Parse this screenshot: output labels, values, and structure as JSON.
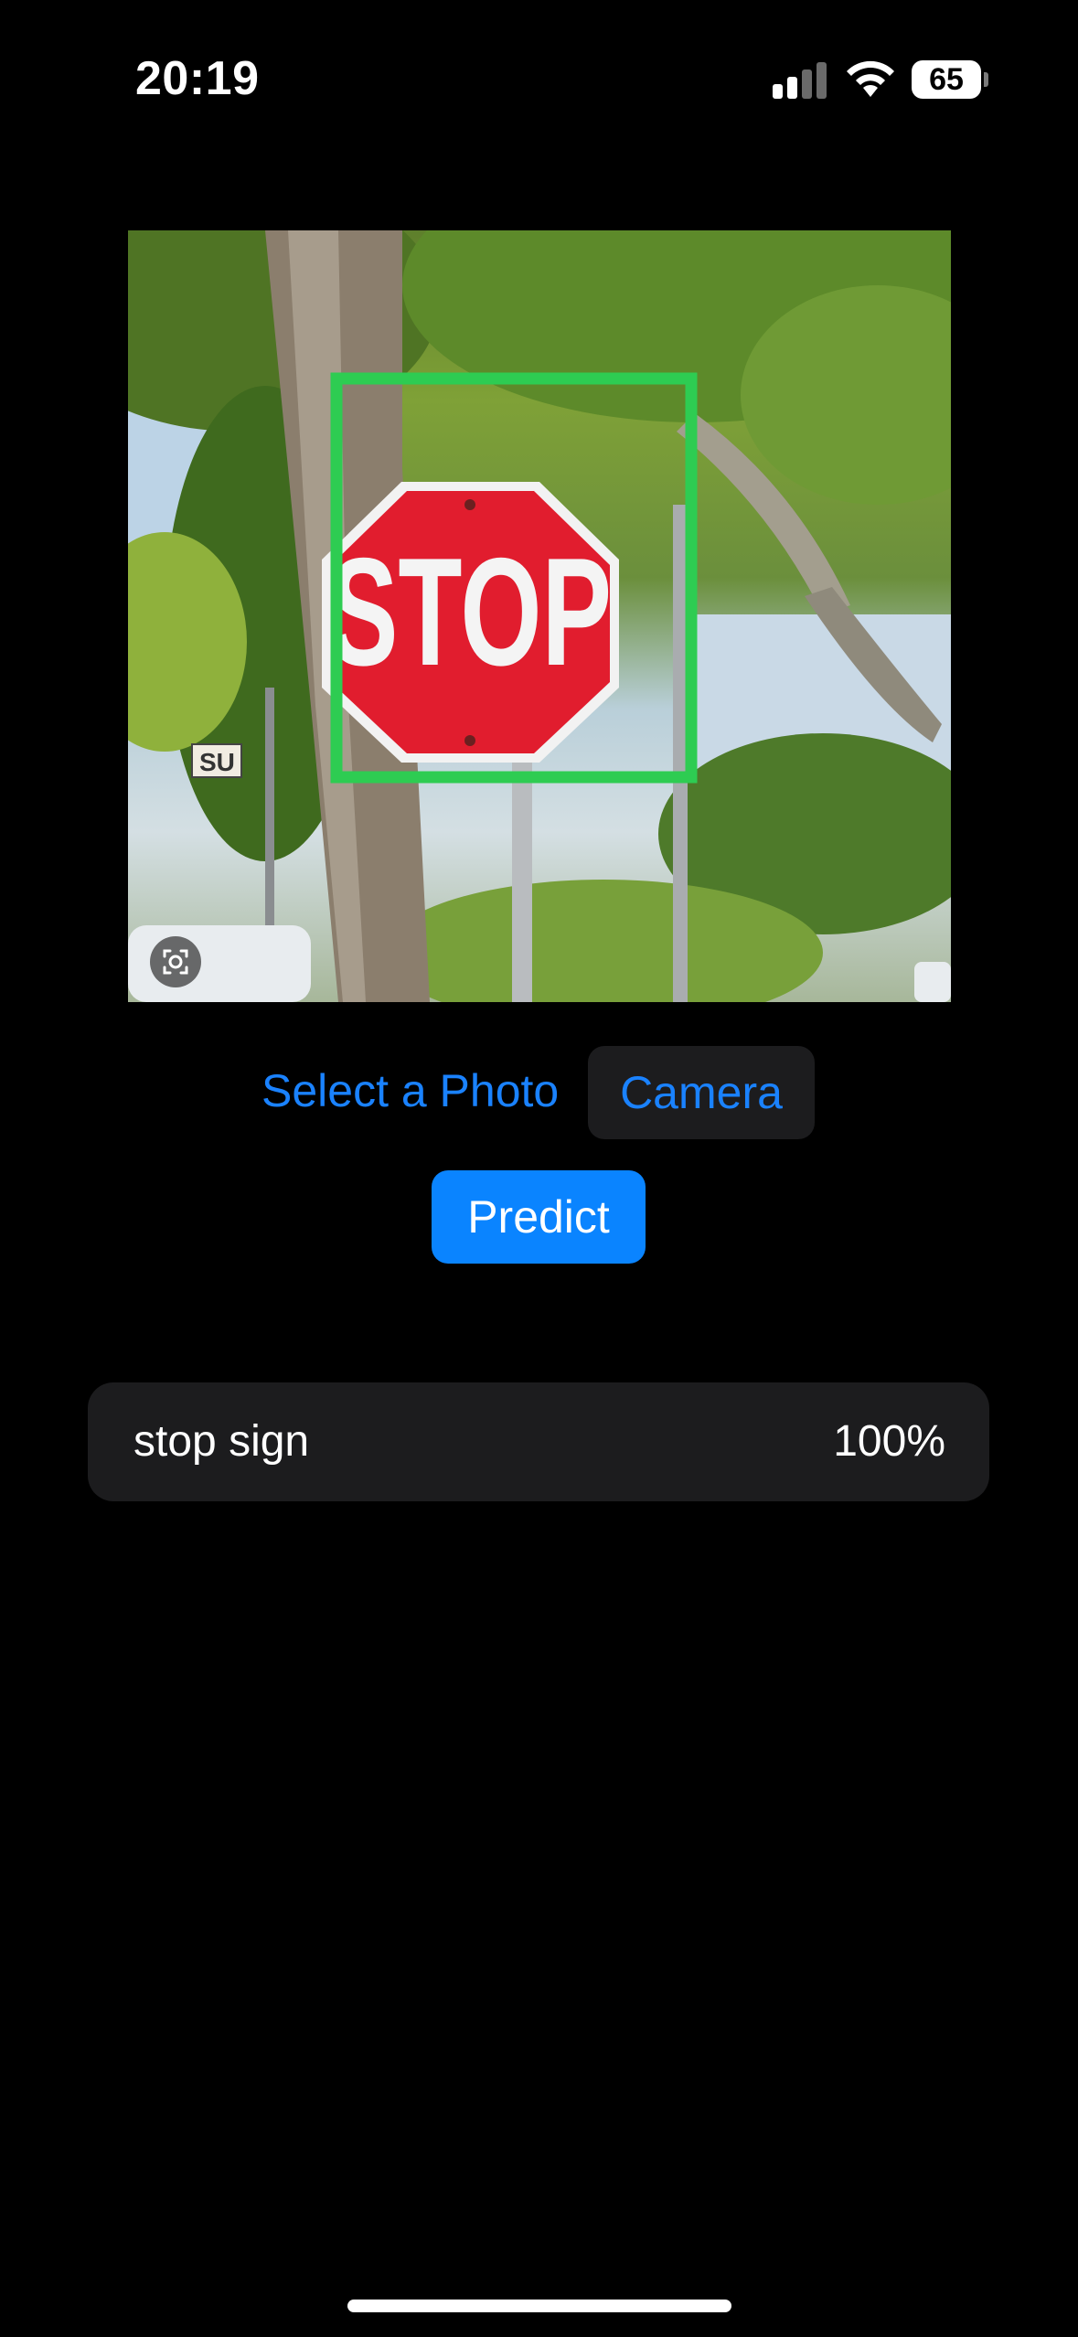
{
  "status_bar": {
    "time": "20:19",
    "battery": "65",
    "signal_bars": 2,
    "signal_bars_total": 4
  },
  "image": {
    "sign_text": "STOP",
    "street_sign_text": "SU",
    "bounding_box_color": "#2ecc52",
    "sign_color": "#e11d2e"
  },
  "actions": {
    "select_photo_label": "Select a Photo",
    "camera_label": "Camera",
    "predict_label": "Predict"
  },
  "result": {
    "label": "stop sign",
    "confidence": "100%"
  },
  "colors": {
    "accent": "#0a84ff",
    "link": "#1a82ff",
    "card_bg": "#1c1c1e"
  }
}
